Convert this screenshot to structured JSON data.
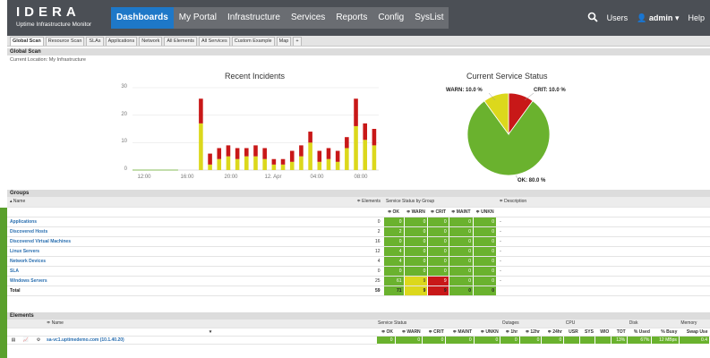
{
  "topbar": {
    "brand": "IDERA",
    "brand_sub": "Uptime Infrastructure Monitor",
    "nav": [
      "Dashboards",
      "My Portal",
      "Infrastructure",
      "Services",
      "Reports",
      "Config",
      "SysList"
    ],
    "users": "Users",
    "admin": "admin",
    "help": "Help"
  },
  "tabs": [
    "Global Scan",
    "Resource Scan",
    "SLAs",
    "Applications",
    "Network",
    "All Elements",
    "All Services",
    "Custom Example",
    "Map",
    "+"
  ],
  "global_scan": {
    "title": "Global Scan",
    "location": "Current Location: My Infrastructure"
  },
  "chart_data": [
    {
      "type": "bar",
      "title": "Recent Incidents",
      "stacked": true,
      "x_ticks": [
        "12:00",
        "16:00",
        "20:00",
        "12. Apr",
        "04:00",
        "08:00"
      ],
      "ylim": [
        0,
        30
      ],
      "y_ticks": [
        0,
        10,
        20,
        30
      ],
      "grid": true,
      "series_colors": {
        "warn": "#dcd81c",
        "crit": "#c81818",
        "ok": "#6ab22e"
      },
      "bars": [
        {
          "warn": 0,
          "crit": 0
        },
        {
          "warn": 0,
          "crit": 0
        },
        {
          "warn": 0,
          "crit": 0
        },
        {
          "warn": 0,
          "crit": 0
        },
        {
          "warn": 0,
          "crit": 0
        },
        {
          "warn": 0,
          "crit": 0
        },
        {
          "warn": 0,
          "crit": 0
        },
        {
          "warn": 17,
          "crit": 9
        },
        {
          "warn": 2,
          "crit": 4
        },
        {
          "warn": 4,
          "crit": 4
        },
        {
          "warn": 5,
          "crit": 4
        },
        {
          "warn": 4,
          "crit": 4
        },
        {
          "warn": 5,
          "crit": 3
        },
        {
          "warn": 5,
          "crit": 4
        },
        {
          "warn": 4,
          "crit": 4
        },
        {
          "warn": 2,
          "crit": 2
        },
        {
          "warn": 2,
          "crit": 2
        },
        {
          "warn": 3,
          "crit": 4
        },
        {
          "warn": 5,
          "crit": 4
        },
        {
          "warn": 10,
          "crit": 4
        },
        {
          "warn": 3,
          "crit": 4
        },
        {
          "warn": 4,
          "crit": 4
        },
        {
          "warn": 3,
          "crit": 4
        },
        {
          "warn": 8,
          "crit": 4
        },
        {
          "warn": 16,
          "crit": 10
        },
        {
          "warn": 11,
          "crit": 6
        },
        {
          "warn": 9,
          "crit": 6
        }
      ]
    },
    {
      "type": "pie",
      "title": "Current Service Status",
      "slices": [
        {
          "label": "OK: 80.0 %",
          "value": 80.0,
          "color": "#6ab22e"
        },
        {
          "label": "WARN: 10.0 %",
          "value": 10.0,
          "color": "#dcd81c"
        },
        {
          "label": "CRIT: 10.0 %",
          "value": 10.0,
          "color": "#c81818"
        }
      ]
    }
  ],
  "groups": {
    "title": "Groups",
    "headers": {
      "name": "▴ Name",
      "elements": "≑ Elements",
      "status": "Service Status by Group",
      "description": "≑ Description"
    },
    "sub_headers": [
      "≑ OK",
      "≑ WARN",
      "≑ CRIT",
      "≑ MAINT",
      "≑ UNKN"
    ],
    "rows": [
      {
        "name": "Applications",
        "elements": "0",
        "ok": "0",
        "warn": "0",
        "crit": "0",
        "maint": "0",
        "unkn": "0",
        "desc": "-"
      },
      {
        "name": "Discovered Hosts",
        "elements": "2",
        "ok": "2",
        "warn": "0",
        "crit": "0",
        "maint": "0",
        "unkn": "0",
        "desc": "-"
      },
      {
        "name": "Discovered Virtual Machines",
        "elements": "16",
        "ok": "0",
        "warn": "0",
        "crit": "0",
        "maint": "0",
        "unkn": "0",
        "desc": "-"
      },
      {
        "name": "Linux Servers",
        "elements": "12",
        "ok": "4",
        "warn": "0",
        "crit": "0",
        "maint": "0",
        "unkn": "0",
        "desc": "-"
      },
      {
        "name": "Network Devices",
        "elements": "4",
        "ok": "4",
        "warn": "0",
        "crit": "0",
        "maint": "0",
        "unkn": "0",
        "desc": "-"
      },
      {
        "name": "SLA",
        "elements": "0",
        "ok": "0",
        "warn": "0",
        "crit": "0",
        "maint": "0",
        "unkn": "0",
        "desc": "-"
      },
      {
        "name": "Windows Servers",
        "elements": "25",
        "ok": "61",
        "warn": "9",
        "crit": "9",
        "maint": "0",
        "unkn": "0",
        "desc": "-"
      }
    ],
    "total": {
      "name": "Total",
      "elements": "59",
      "ok": "71",
      "warn": "9",
      "crit": "9",
      "maint": "0",
      "unkn": "0"
    }
  },
  "elements": {
    "title": "Elements",
    "headers": {
      "name": "≑ Name",
      "service_status": "Service Status",
      "outages": "Outages",
      "cpu": "CPU",
      "disk": "Disk",
      "memory": "Memory"
    },
    "sub_headers": [
      "≑ OK",
      "≑ WARN",
      "≑ CRIT",
      "≑ MAINT",
      "≑ UNKN",
      "≑ 1hr",
      "≑ 12hr",
      "≑ 24hr",
      "USR",
      "SYS",
      "WIO",
      "TOT",
      "% Used",
      "% Busy",
      "Swap Use"
    ],
    "rows": [
      {
        "name": "sa-vc1.uptimedemo.com (10.1.40.20)",
        "ok": "0",
        "warn": "0",
        "crit": "0",
        "maint": "0",
        "unkn": "0",
        "h1": "0",
        "h12": "0",
        "h24": "0",
        "usr": "",
        "sys": "",
        "wio": "",
        "tot": "13%",
        "used": "67%",
        "busy": "12 MBps",
        "swap": "0.4"
      }
    ]
  }
}
